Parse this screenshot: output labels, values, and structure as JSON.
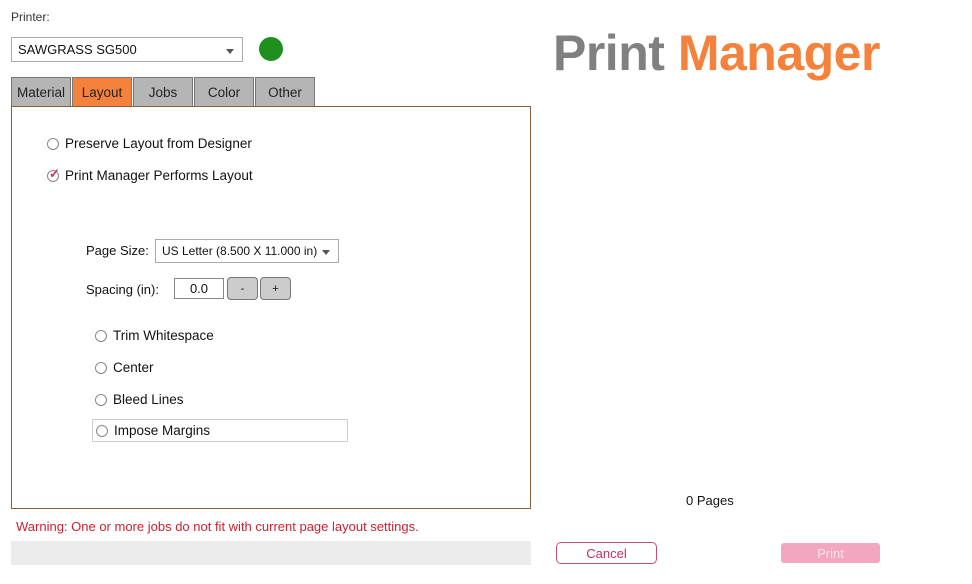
{
  "printer": {
    "label": "Printer:",
    "selected": "SAWGRASS SG500",
    "status_color": "#1f8f1f"
  },
  "tabs": [
    {
      "label": "Material"
    },
    {
      "label": "Layout",
      "active": true
    },
    {
      "label": "Jobs"
    },
    {
      "label": "Color"
    },
    {
      "label": "Other"
    }
  ],
  "layout": {
    "mode_options": [
      {
        "label": "Preserve Layout from Designer",
        "checked": false
      },
      {
        "label": "Print Manager Performs Layout",
        "checked": true
      }
    ],
    "page_size_label": "Page Size:",
    "page_size_value": "US Letter (8.500 X 11.000 in)",
    "spacing_label": "Spacing (in):",
    "spacing_value": "0.0",
    "minus": "-",
    "plus": "+",
    "options": [
      {
        "label": "Trim Whitespace"
      },
      {
        "label": "Center"
      },
      {
        "label": "Bleed Lines"
      },
      {
        "label": "Impose Margins"
      }
    ]
  },
  "warning": "Warning:  One or more jobs do not fit with current page layout settings.",
  "logo": {
    "part1": "Print",
    "part2": "Manager",
    "color1": "#808080",
    "color2": "#f5823c"
  },
  "pages": "0 Pages",
  "cancel": "Cancel",
  "print": "Print"
}
